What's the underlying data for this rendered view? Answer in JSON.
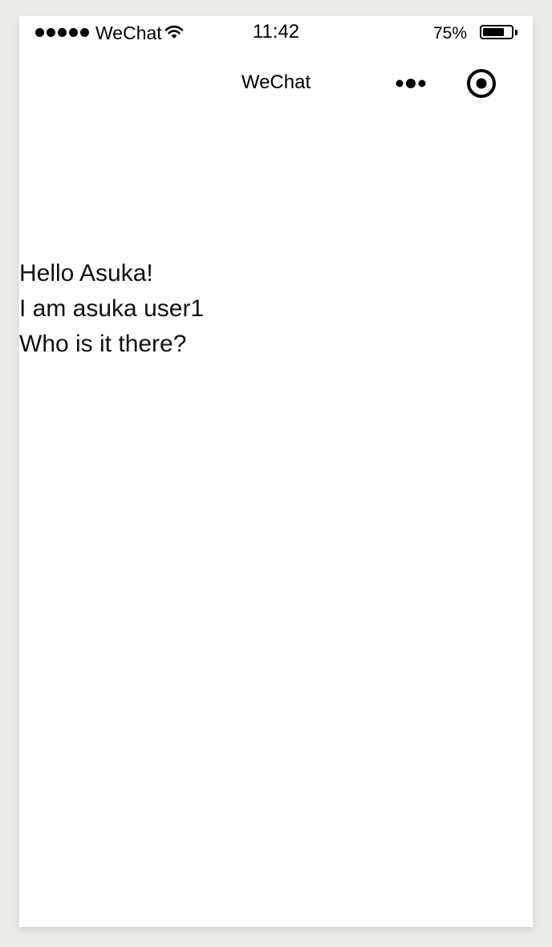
{
  "status_bar": {
    "carrier": "WeChat",
    "time": "11:42",
    "battery_percent": "75%",
    "battery_level": 0.75,
    "signal_icon": "signal-dots-icon",
    "wifi_icon": "wifi-icon",
    "battery_icon": "battery-icon"
  },
  "nav": {
    "title": "WeChat",
    "more_icon": "more-dots-icon",
    "close_icon": "target-circle-icon"
  },
  "content": {
    "lines": [
      "Hello Asuka!",
      "I am asuka user1",
      "Who is it there?"
    ]
  },
  "colors": {
    "background": "#ecebe7",
    "screen": "#ffffff",
    "text": "#000000"
  }
}
